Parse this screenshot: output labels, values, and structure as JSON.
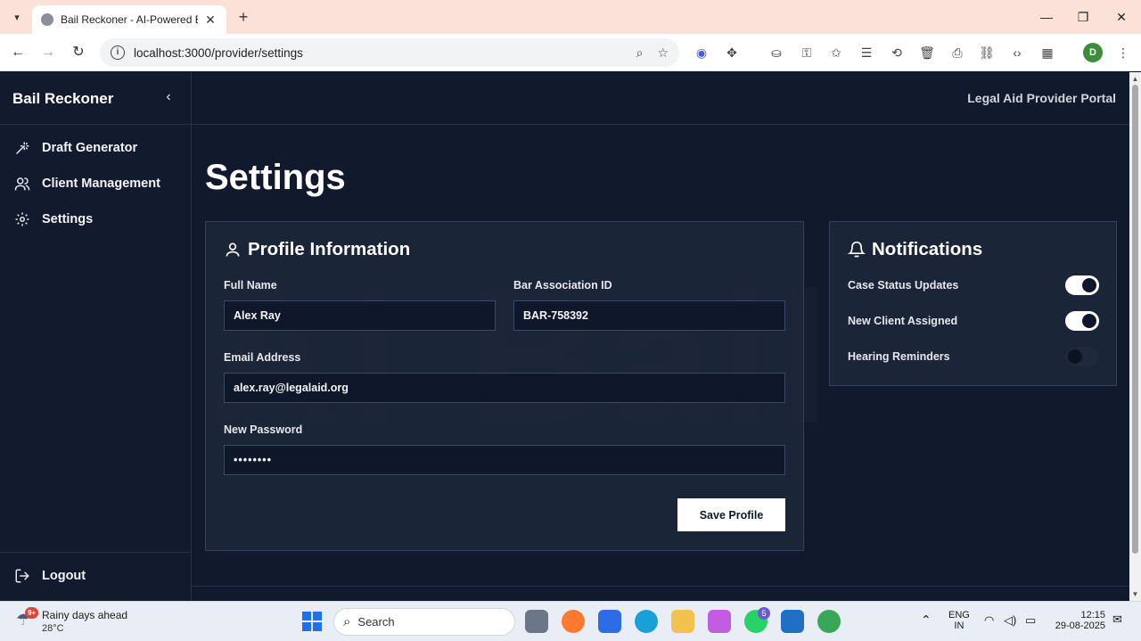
{
  "browser": {
    "tab_title": "Bail Reckoner - AI-Powered Bail",
    "url": "localhost:3000/provider/settings",
    "profile_initial": "D"
  },
  "sidebar": {
    "brand": "Bail Reckoner",
    "items": [
      {
        "label": "Draft Generator",
        "icon": "wand-icon"
      },
      {
        "label": "Client Management",
        "icon": "users-icon"
      },
      {
        "label": "Settings",
        "icon": "gear-icon"
      }
    ],
    "logout": "Logout"
  },
  "header": {
    "portal": "Legal Aid Provider Portal"
  },
  "page": {
    "title": "Settings"
  },
  "profile": {
    "title": "Profile Information",
    "full_name_label": "Full Name",
    "full_name": "Alex Ray",
    "bar_id_label": "Bar Association ID",
    "bar_id": "BAR-758392",
    "email_label": "Email Address",
    "email": "alex.ray@legalaid.org",
    "password_label": "New Password",
    "password": "••••••••",
    "save_label": "Save Profile"
  },
  "notifications": {
    "title": "Notifications",
    "items": [
      {
        "label": "Case Status Updates",
        "enabled": true
      },
      {
        "label": "New Client Assigned",
        "enabled": true
      },
      {
        "label": "Hearing Reminders",
        "enabled": false
      }
    ]
  },
  "taskbar": {
    "weather_title": "Rainy days ahead",
    "weather_temp": "28°C",
    "weather_badge": "9+",
    "search_label": "Search",
    "whatsapp_badge": "5",
    "lang_1": "ENG",
    "lang_2": "IN",
    "time": "12:15",
    "date": "29-08-2025"
  },
  "colors": {
    "app_bg": "#111a2c",
    "card_bg": "#1e293b",
    "accent_white": "#ffffff",
    "tab_strip": "#fbe1d8"
  }
}
